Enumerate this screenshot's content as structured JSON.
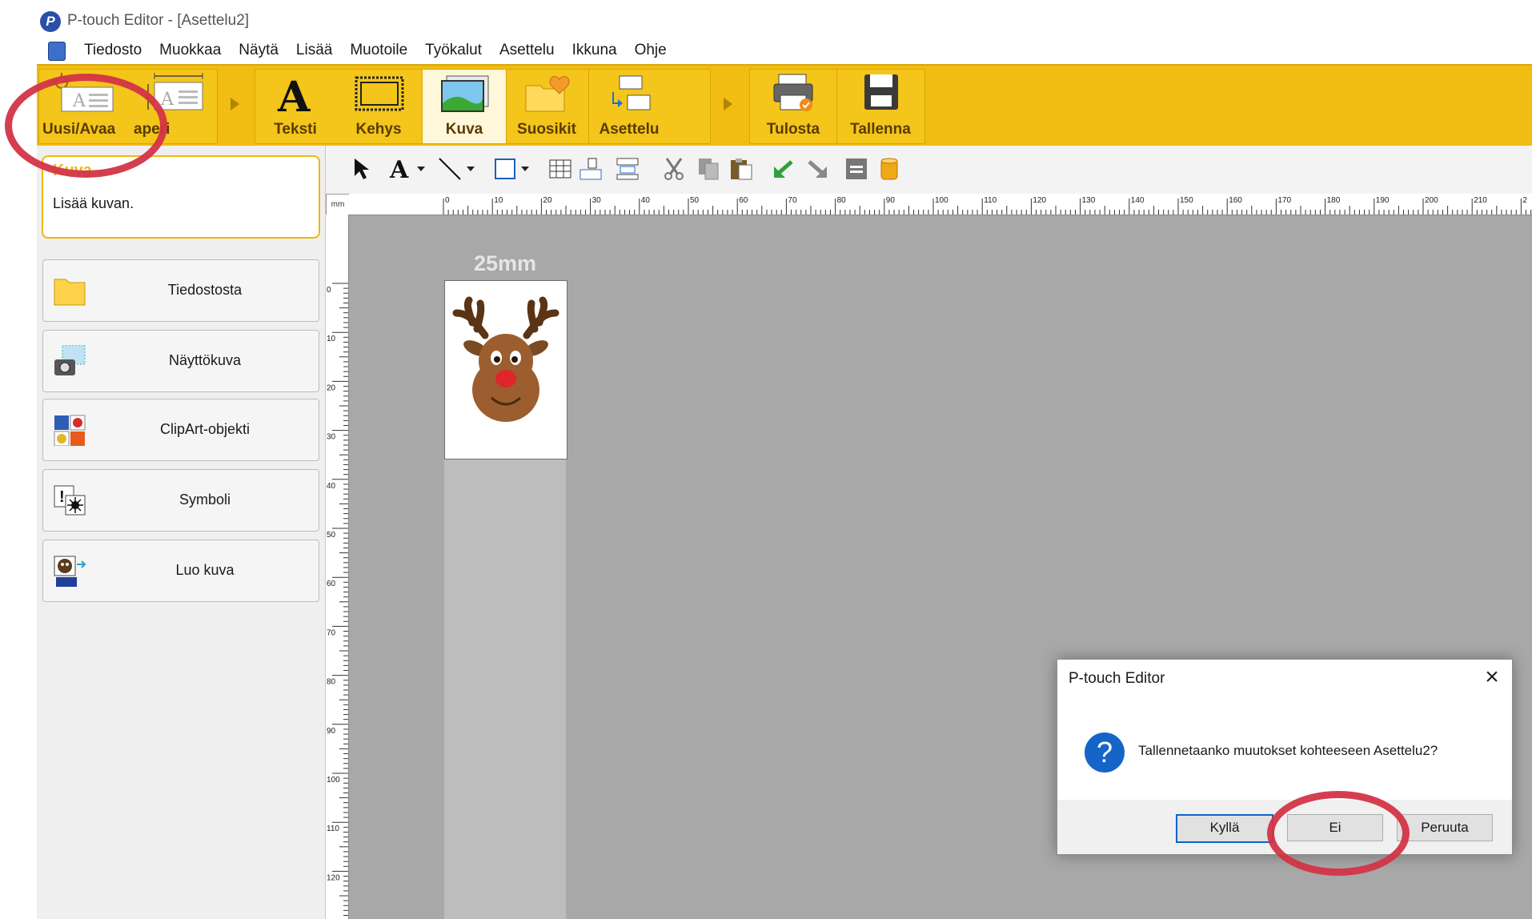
{
  "window": {
    "title": "P-touch Editor - [Asettelu2]"
  },
  "menu": [
    "Tiedosto",
    "Muokkaa",
    "Näytä",
    "Lisää",
    "Muotoile",
    "Työkalut",
    "Asettelu",
    "Ikkuna",
    "Ohje"
  ],
  "ribbon": {
    "new_open": "Uusi/Avaa",
    "paper": "aperi",
    "text": "Teksti",
    "frame": "Kehys",
    "image": "Kuva",
    "favorites": "Suosikit",
    "layout": "Asettelu",
    "print": "Tulosta",
    "save": "Tallenna"
  },
  "side_panel": {
    "title": "Kuva",
    "description": "Lisää kuvan.",
    "buttons": [
      "Tiedostosta",
      "Näyttökuva",
      "ClipArt-objekti",
      "Symboli",
      "Luo kuva"
    ]
  },
  "ruler": {
    "unit": "mm",
    "h_ticks": [
      "0",
      "10",
      "20",
      "30",
      "40",
      "50",
      "60",
      "70",
      "80",
      "90",
      "100",
      "110",
      "120",
      "130",
      "140",
      "150",
      "160",
      "170",
      "180",
      "190",
      "200",
      "210",
      "2"
    ],
    "v_ticks": [
      "0",
      "10",
      "20",
      "30",
      "40",
      "50",
      "60",
      "70",
      "80",
      "90",
      "100",
      "110",
      "120"
    ]
  },
  "canvas": {
    "tape_width": "25mm"
  },
  "dialog": {
    "title": "P-touch Editor",
    "message": "Tallennetaanko muutokset kohteeseen Asettelu2?",
    "yes": "Kyllä",
    "no": "Ei",
    "cancel": "Peruuta",
    "close_icon": "close-icon"
  },
  "colors": {
    "ribbon": "#f2bd12",
    "annotation": "#d33446",
    "canvas": "#a8a8a8"
  }
}
